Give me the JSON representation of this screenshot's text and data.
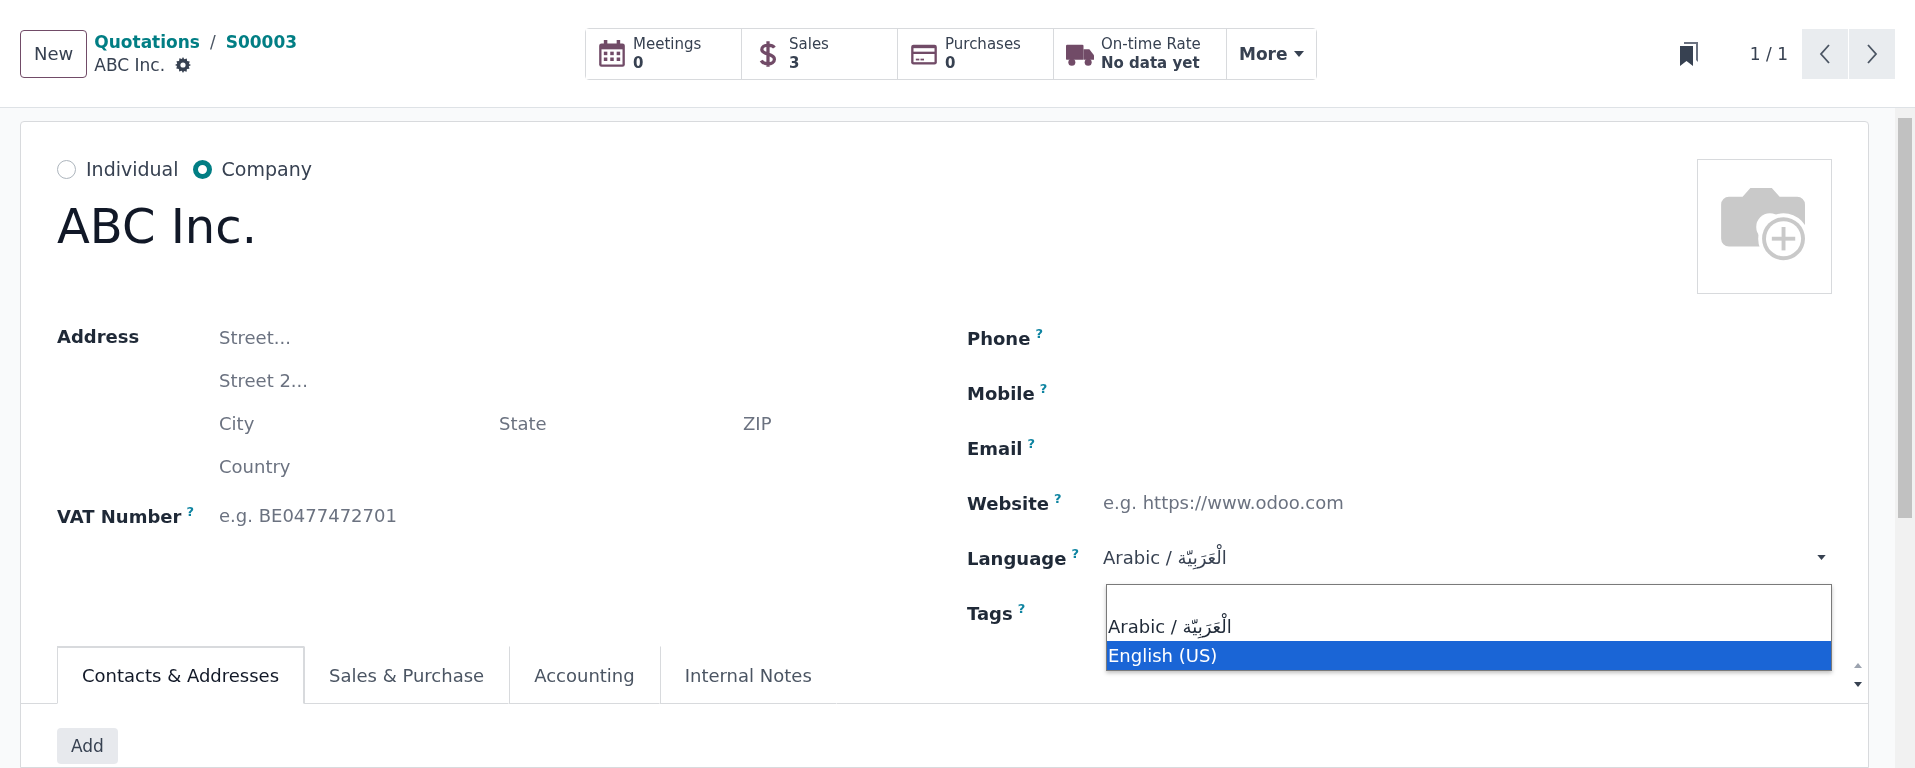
{
  "control_panel": {
    "new_button": "New",
    "breadcrumb": {
      "parent": "Quotations",
      "separator": "/",
      "current": "S00003"
    },
    "record_name": "ABC Inc.",
    "stat_buttons": [
      {
        "kind": "calendar",
        "label": "Meetings",
        "value": "0"
      },
      {
        "kind": "dollar",
        "label": "Sales",
        "value": "3"
      },
      {
        "kind": "card",
        "label": "Purchases",
        "value": "0"
      },
      {
        "kind": "truck",
        "label": "On-time Rate",
        "value": "No data yet"
      }
    ],
    "more_button": "More",
    "pager": "1 / 1"
  },
  "form": {
    "company_type": [
      {
        "label": "Individual",
        "selected": false
      },
      {
        "label": "Company",
        "selected": true
      }
    ],
    "name": "ABC Inc.",
    "address": {
      "label": "Address",
      "street": {
        "placeholder": "Street..."
      },
      "street2": {
        "placeholder": "Street 2..."
      },
      "city": {
        "placeholder": "City"
      },
      "state": {
        "placeholder": "State"
      },
      "zip": {
        "placeholder": "ZIP"
      },
      "country": {
        "placeholder": "Country"
      }
    },
    "vat": {
      "label": "VAT Number",
      "help": "?",
      "placeholder": "e.g. BE0477472701"
    },
    "right_fields": [
      {
        "kind": "text",
        "label": "Phone",
        "help": "?"
      },
      {
        "kind": "text",
        "label": "Mobile",
        "help": "?"
      },
      {
        "kind": "text",
        "label": "Email",
        "help": "?"
      },
      {
        "kind": "text",
        "label": "Website",
        "help": "?",
        "placeholder": "e.g. https://www.odoo.com"
      },
      {
        "kind": "select",
        "label": "Language",
        "help": "?",
        "value": "Arabic / الْعَرَبِيّة"
      },
      {
        "kind": "text",
        "label": "Tags",
        "help": "?"
      }
    ],
    "language_options": [
      {
        "label": "Arabic / الْعَرَبِيّة",
        "selected": false
      },
      {
        "label": "English (US)",
        "selected": true
      }
    ],
    "tabs": [
      {
        "label": "Contacts & Addresses",
        "selected": true
      },
      {
        "label": "Sales & Purchase",
        "selected": false
      },
      {
        "label": "Accounting",
        "selected": false
      },
      {
        "label": "Internal Notes",
        "selected": false
      }
    ],
    "add_button": "Add"
  }
}
